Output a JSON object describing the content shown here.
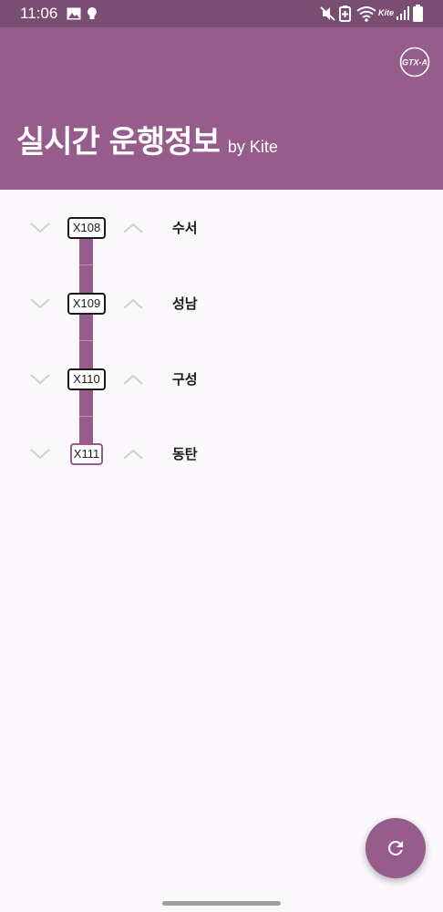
{
  "status_bar": {
    "time": "11:06",
    "left_icons": [
      "image-icon",
      "bulb-icon"
    ],
    "right_icons": [
      "mute-icon",
      "battery-saver-icon",
      "wifi-icon",
      "signal-icon",
      "battery-icon"
    ],
    "network_label": "Kite"
  },
  "app_bar": {
    "title": "실시간 운행정보",
    "subtitle": "by Kite",
    "logo_text": "GTX-A",
    "background": "#965c8c"
  },
  "stations": [
    {
      "code": "X108",
      "name": "수서"
    },
    {
      "code": "X109",
      "name": "성남"
    },
    {
      "code": "X110",
      "name": "구성"
    },
    {
      "code": "X111",
      "name": "동탄"
    }
  ],
  "fab": {
    "icon": "refresh-icon"
  },
  "colors": {
    "accent": "#965c8c",
    "status_bar": "#7a4d72",
    "background": "#fbf8fc",
    "chevron": "#d0d0d0"
  }
}
